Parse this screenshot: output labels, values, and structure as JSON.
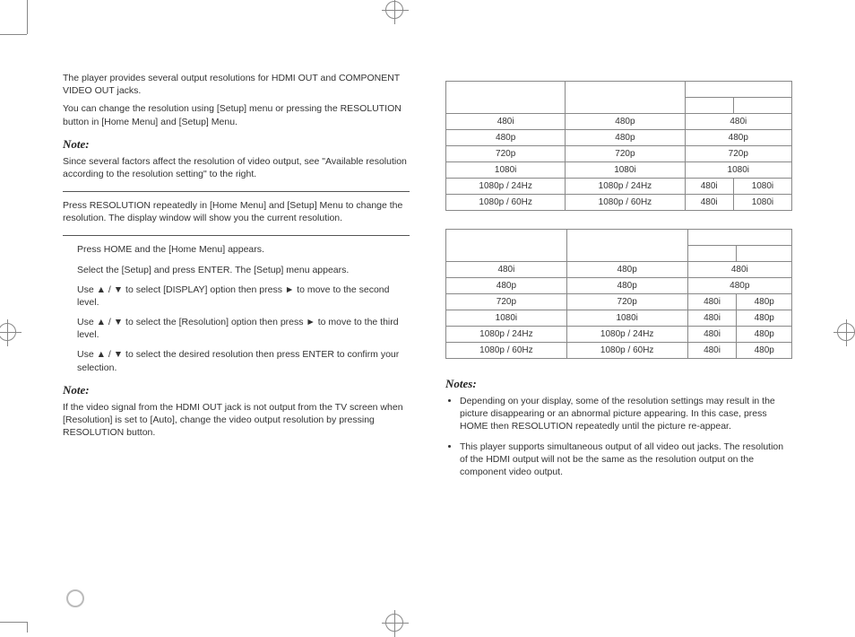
{
  "left": {
    "intro1": "The player provides several output resolutions for HDMI OUT  and COMPONENT VIDEO OUT jacks.",
    "intro2": "You can change the resolution using [Setup] menu or pressing the RESOLUTION button in [Home Menu] and [Setup] Menu.",
    "note1_label": "Note:",
    "note1_body": "Since several factors affect the resolution of video output, see \"Available resolution according to the resolution setting\" to the right.",
    "press_res": "Press RESOLUTION repeatedly in [Home Menu] and [Setup] Menu to change the resolution. The display window will show you the current resolution.",
    "steps": [
      "Press HOME and the [Home Menu] appears.",
      "Select the [Setup] and press ENTER.  The [Setup] menu appears.",
      "Use ▲ / ▼ to select [DISPLAY] option then press ► to move to the second level.",
      "Use ▲ / ▼ to select the [Resolution] option then press ► to move to the third level.",
      "Use ▲ / ▼ to select the desired resolution then press ENTER to confirm your selection."
    ],
    "note2_label": "Note:",
    "note2_body": "If the video signal from the HDMI OUT  jack is not output from the TV screen when [Resolution] is set to [Auto], change the video output resolution by pressing RESOLUTION button."
  },
  "right": {
    "table1": {
      "rows": [
        [
          "480i",
          "480p",
          "480i",
          ""
        ],
        [
          "480p",
          "480p",
          "480p",
          ""
        ],
        [
          "720p",
          "720p",
          "720p",
          ""
        ],
        [
          "1080i",
          "1080i",
          "1080i",
          ""
        ],
        [
          "1080p / 24Hz",
          "1080p / 24Hz",
          "480i",
          "1080i"
        ],
        [
          "1080p / 60Hz",
          "1080p / 60Hz",
          "480i",
          "1080i"
        ]
      ]
    },
    "table2": {
      "rows": [
        [
          "480i",
          "480p",
          "480i",
          ""
        ],
        [
          "480p",
          "480p",
          "480p",
          ""
        ],
        [
          "720p",
          "720p",
          "480i",
          "480p"
        ],
        [
          "1080i",
          "1080i",
          "480i",
          "480p"
        ],
        [
          "1080p / 24Hz",
          "1080p / 24Hz",
          "480i",
          "480p"
        ],
        [
          "1080p / 60Hz",
          "1080p / 60Hz",
          "480i",
          "480p"
        ]
      ]
    },
    "notes_label": "Notes:",
    "bullets": [
      "Depending on your display, some of the resolution settings may result in the picture disappearing or an abnormal picture appearing. In this case, press HOME then RESOLUTION repeatedly until the picture re-appear.",
      "This player supports simultaneous output of all video out jacks.  The resolution of the HDMI output will not be the same as the resolution output on the component video output."
    ]
  }
}
